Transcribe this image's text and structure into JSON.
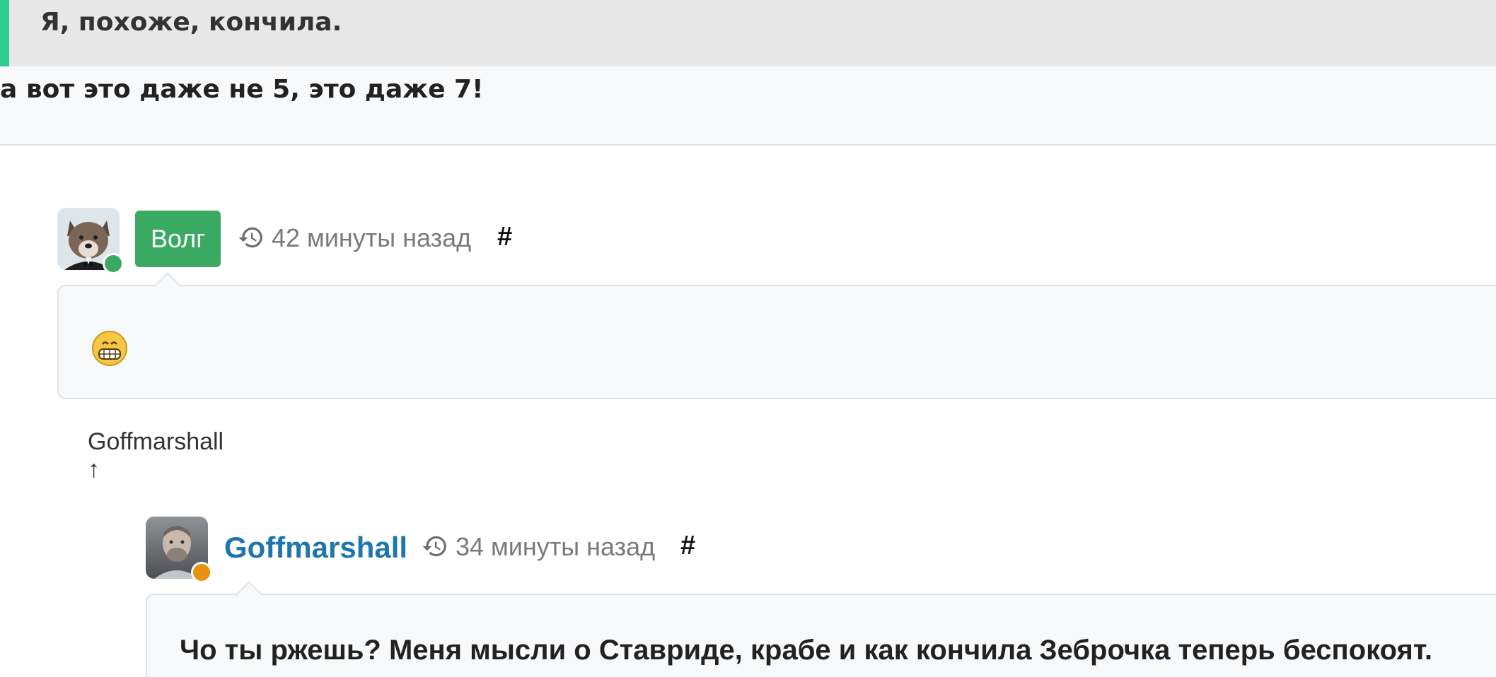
{
  "quote": {
    "text": "Я, похоже, кончила."
  },
  "parent_comment": {
    "text": "а вот это даже не 5, это даже 7!"
  },
  "comments": [
    {
      "author": "Волг",
      "time": "42 минуты назад",
      "permalink": "#",
      "body_emoji": "grinning-face-emoji",
      "status_color": "#3aaa63",
      "reply_link": "Goffmarshall ↑"
    },
    {
      "author": "Goffmarshall",
      "time": "34 минуты назад",
      "permalink": "#",
      "body_text": "Чо ты ржешь? Меня мысли о Ставриде, крабе и как кончила Зеброчка теперь беспокоят.",
      "status_color": "#e8920f"
    }
  ],
  "colors": {
    "quote_bar": "#2ecc8f",
    "author_badge": "#3aaa63",
    "author_link": "#1f75ad"
  }
}
